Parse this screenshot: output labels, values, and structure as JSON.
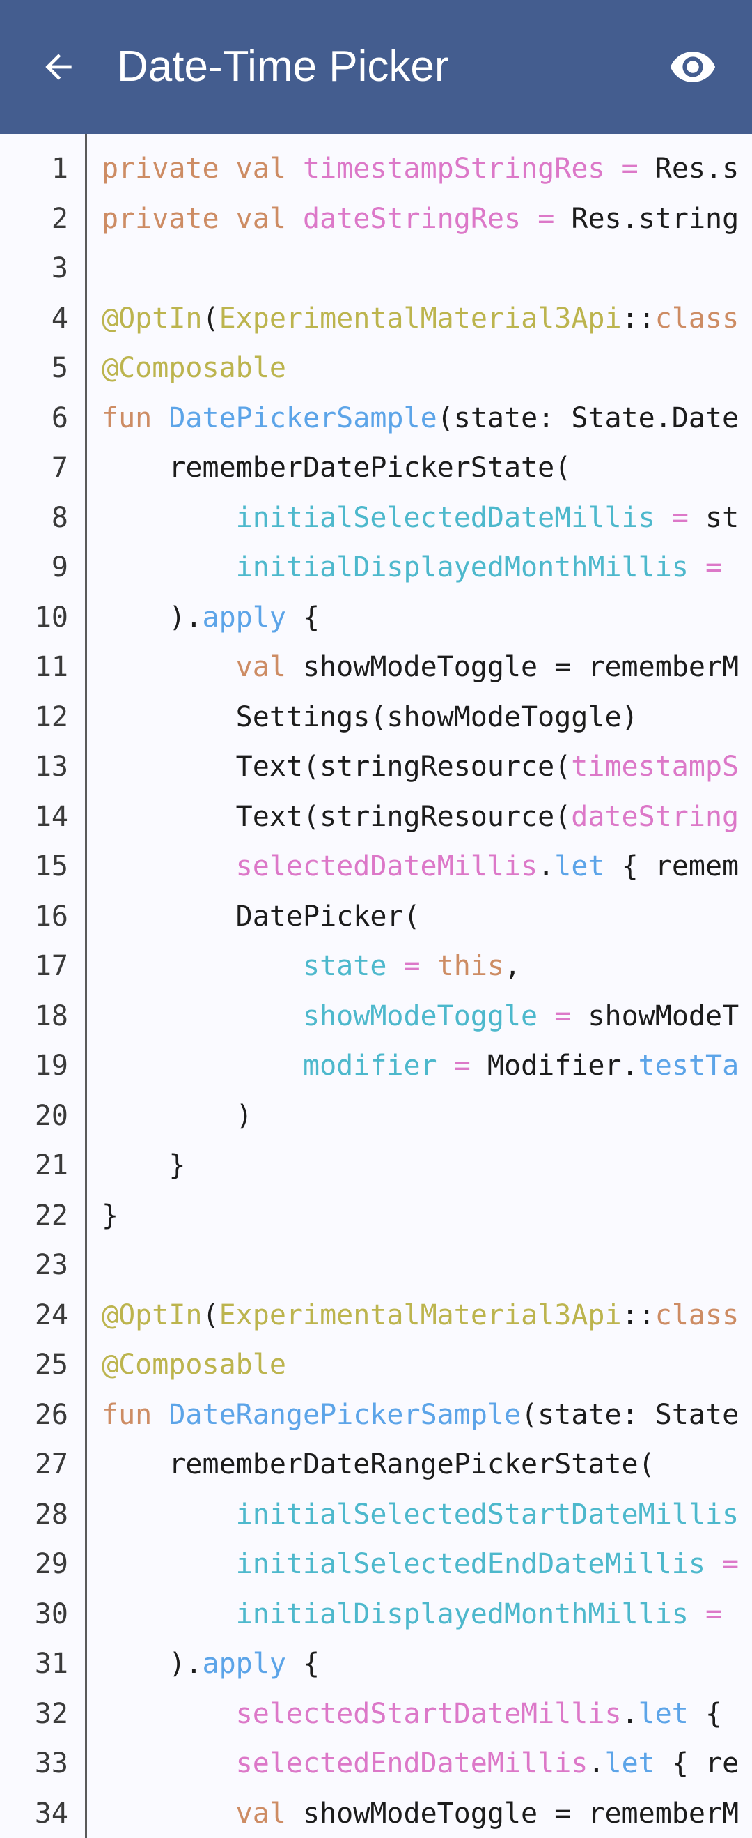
{
  "header": {
    "title": "Date-Time Picker",
    "background": "#445d8f",
    "back_icon": "arrow-left-icon",
    "preview_icon": "eye-icon"
  },
  "colors": {
    "keyword": "#cd8c64",
    "property": "#dc78c8",
    "annotation": "#bcb44e",
    "function": "#5ca4e8",
    "parameter": "#4db8cc",
    "plain": "#1c1c1c",
    "line_number": "#3a3a3a"
  },
  "lines": [
    {
      "n": "1",
      "tokens": [
        [
          "kw",
          "private"
        ],
        [
          "plain",
          " "
        ],
        [
          "kw",
          "val"
        ],
        [
          "plain",
          " "
        ],
        [
          "prop",
          "timestampStringRes"
        ],
        [
          "plain",
          " "
        ],
        [
          "op",
          "="
        ],
        [
          "plain",
          " Res.s"
        ]
      ]
    },
    {
      "n": "2",
      "tokens": [
        [
          "kw",
          "private"
        ],
        [
          "plain",
          " "
        ],
        [
          "kw",
          "val"
        ],
        [
          "plain",
          " "
        ],
        [
          "prop",
          "dateStringRes"
        ],
        [
          "plain",
          " "
        ],
        [
          "op",
          "="
        ],
        [
          "plain",
          " Res.string"
        ]
      ]
    },
    {
      "n": "3",
      "tokens": []
    },
    {
      "n": "4",
      "tokens": [
        [
          "ann",
          "@OptIn"
        ],
        [
          "plain",
          "("
        ],
        [
          "ann",
          "ExperimentalMaterial3Api"
        ],
        [
          "plain",
          "::"
        ],
        [
          "kw",
          "class"
        ]
      ]
    },
    {
      "n": "5",
      "tokens": [
        [
          "ann",
          "@Composable"
        ]
      ]
    },
    {
      "n": "6",
      "tokens": [
        [
          "kw",
          "fun"
        ],
        [
          "plain",
          " "
        ],
        [
          "fn",
          "DatePickerSample"
        ],
        [
          "plain",
          "(state: State.Date"
        ]
      ]
    },
    {
      "n": "7",
      "tokens": [
        [
          "plain",
          "    rememberDatePickerState("
        ]
      ]
    },
    {
      "n": "8",
      "tokens": [
        [
          "plain",
          "        "
        ],
        [
          "param",
          "initialSelectedDateMillis"
        ],
        [
          "plain",
          " "
        ],
        [
          "op",
          "="
        ],
        [
          "plain",
          " st"
        ]
      ]
    },
    {
      "n": "9",
      "tokens": [
        [
          "plain",
          "        "
        ],
        [
          "param",
          "initialDisplayedMonthMillis"
        ],
        [
          "plain",
          " "
        ],
        [
          "op",
          "="
        ]
      ]
    },
    {
      "n": "10",
      "tokens": [
        [
          "plain",
          "    )."
        ],
        [
          "fn",
          "apply"
        ],
        [
          "plain",
          " {"
        ]
      ]
    },
    {
      "n": "11",
      "tokens": [
        [
          "plain",
          "        "
        ],
        [
          "kw",
          "val"
        ],
        [
          "plain",
          " showModeToggle = rememberM"
        ]
      ]
    },
    {
      "n": "12",
      "tokens": [
        [
          "plain",
          "        Settings(showModeToggle)"
        ]
      ]
    },
    {
      "n": "13",
      "tokens": [
        [
          "plain",
          "        Text(stringResource("
        ],
        [
          "prop",
          "timestampS"
        ]
      ]
    },
    {
      "n": "14",
      "tokens": [
        [
          "plain",
          "        Text(stringResource("
        ],
        [
          "prop",
          "dateString"
        ]
      ]
    },
    {
      "n": "15",
      "tokens": [
        [
          "plain",
          "        "
        ],
        [
          "prop",
          "selectedDateMillis"
        ],
        [
          "plain",
          "."
        ],
        [
          "fn",
          "let"
        ],
        [
          "plain",
          " { remem"
        ]
      ]
    },
    {
      "n": "16",
      "tokens": [
        [
          "plain",
          "        DatePicker("
        ]
      ]
    },
    {
      "n": "17",
      "tokens": [
        [
          "plain",
          "            "
        ],
        [
          "param",
          "state"
        ],
        [
          "plain",
          " "
        ],
        [
          "op",
          "="
        ],
        [
          "plain",
          " "
        ],
        [
          "kw",
          "this"
        ],
        [
          "plain",
          ","
        ]
      ]
    },
    {
      "n": "18",
      "tokens": [
        [
          "plain",
          "            "
        ],
        [
          "param",
          "showModeToggle"
        ],
        [
          "plain",
          " "
        ],
        [
          "op",
          "="
        ],
        [
          "plain",
          " showModeT"
        ]
      ]
    },
    {
      "n": "19",
      "tokens": [
        [
          "plain",
          "            "
        ],
        [
          "param",
          "modifier"
        ],
        [
          "plain",
          " "
        ],
        [
          "op",
          "="
        ],
        [
          "plain",
          " Modifier."
        ],
        [
          "fn",
          "testTa"
        ]
      ]
    },
    {
      "n": "20",
      "tokens": [
        [
          "plain",
          "        )"
        ]
      ]
    },
    {
      "n": "21",
      "tokens": [
        [
          "plain",
          "    }"
        ]
      ]
    },
    {
      "n": "22",
      "tokens": [
        [
          "plain",
          "}"
        ]
      ]
    },
    {
      "n": "23",
      "tokens": []
    },
    {
      "n": "24",
      "tokens": [
        [
          "ann",
          "@OptIn"
        ],
        [
          "plain",
          "("
        ],
        [
          "ann",
          "ExperimentalMaterial3Api"
        ],
        [
          "plain",
          "::"
        ],
        [
          "kw",
          "class"
        ]
      ]
    },
    {
      "n": "25",
      "tokens": [
        [
          "ann",
          "@Composable"
        ]
      ]
    },
    {
      "n": "26",
      "tokens": [
        [
          "kw",
          "fun"
        ],
        [
          "plain",
          " "
        ],
        [
          "fn",
          "DateRangePickerSample"
        ],
        [
          "plain",
          "(state: State"
        ]
      ]
    },
    {
      "n": "27",
      "tokens": [
        [
          "plain",
          "    rememberDateRangePickerState("
        ]
      ]
    },
    {
      "n": "28",
      "tokens": [
        [
          "plain",
          "        "
        ],
        [
          "param",
          "initialSelectedStartDateMillis"
        ]
      ]
    },
    {
      "n": "29",
      "tokens": [
        [
          "plain",
          "        "
        ],
        [
          "param",
          "initialSelectedEndDateMillis"
        ],
        [
          "plain",
          " "
        ],
        [
          "op",
          "="
        ]
      ]
    },
    {
      "n": "30",
      "tokens": [
        [
          "plain",
          "        "
        ],
        [
          "param",
          "initialDisplayedMonthMillis"
        ],
        [
          "plain",
          " "
        ],
        [
          "op",
          "="
        ]
      ]
    },
    {
      "n": "31",
      "tokens": [
        [
          "plain",
          "    )."
        ],
        [
          "fn",
          "apply"
        ],
        [
          "plain",
          " {"
        ]
      ]
    },
    {
      "n": "32",
      "tokens": [
        [
          "plain",
          "        "
        ],
        [
          "prop",
          "selectedStartDateMillis"
        ],
        [
          "plain",
          "."
        ],
        [
          "fn",
          "let"
        ],
        [
          "plain",
          " {"
        ]
      ]
    },
    {
      "n": "33",
      "tokens": [
        [
          "plain",
          "        "
        ],
        [
          "prop",
          "selectedEndDateMillis"
        ],
        [
          "plain",
          "."
        ],
        [
          "fn",
          "let"
        ],
        [
          "plain",
          " { re"
        ]
      ]
    },
    {
      "n": "34",
      "tokens": [
        [
          "plain",
          "        "
        ],
        [
          "kw",
          "val"
        ],
        [
          "plain",
          " showModeToggle = rememberM"
        ]
      ]
    }
  ]
}
